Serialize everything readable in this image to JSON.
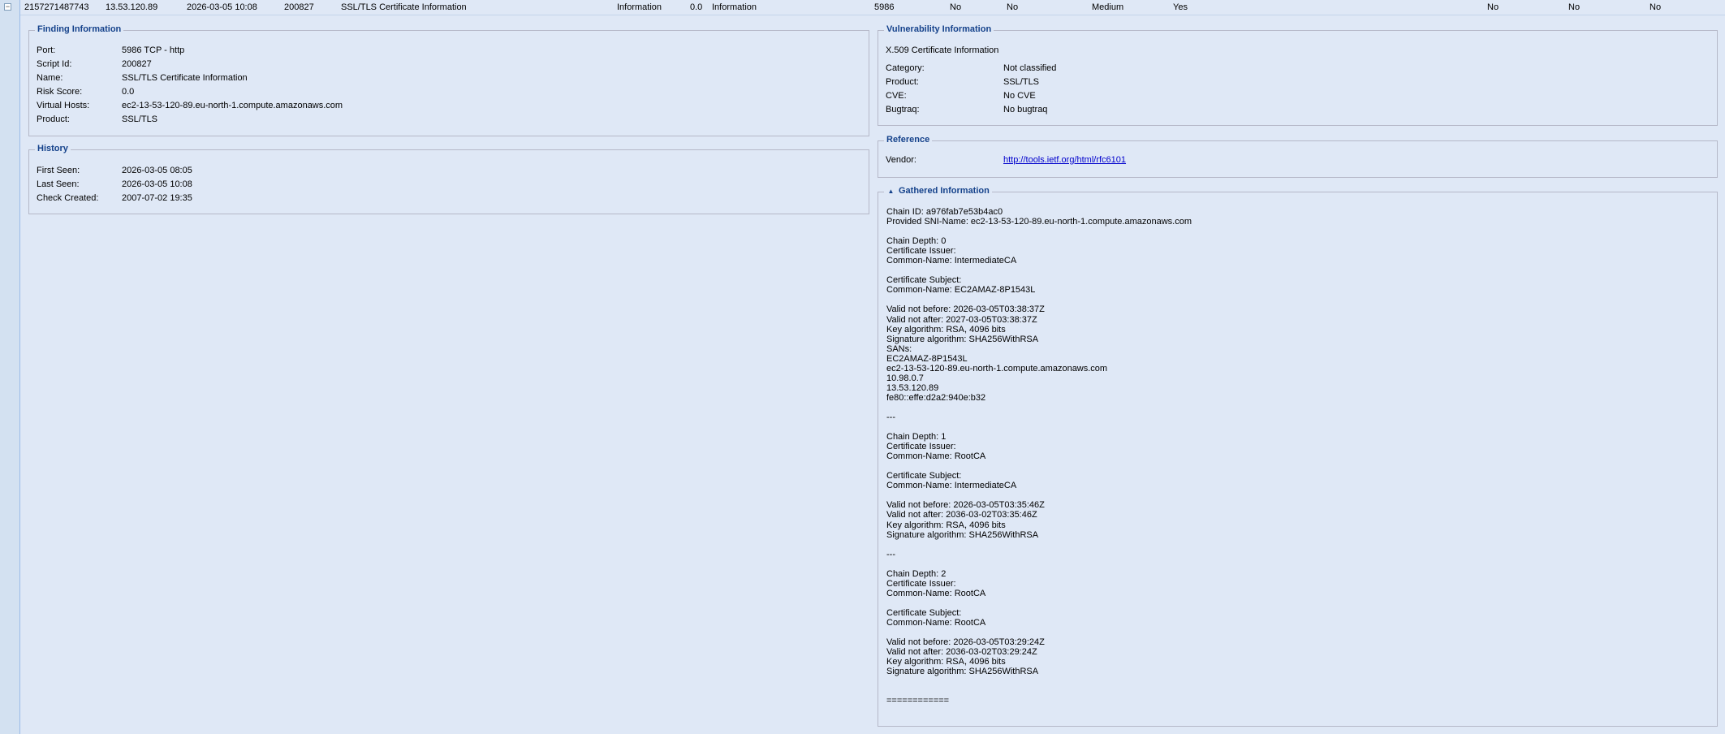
{
  "row": {
    "cells": [
      "2157271487743",
      "13.53.120.89",
      "2026-03-05 10:08",
      "200827",
      "SSL/TLS Certificate Information",
      "Information",
      "0.0",
      "Information",
      "5986",
      "No",
      "No",
      "Medium",
      "Yes",
      "No",
      "No",
      "No"
    ]
  },
  "finding": {
    "title": "Finding Information",
    "fields": [
      {
        "label": "Port:",
        "value": "5986 TCP - http"
      },
      {
        "label": "Script Id:",
        "value": "200827"
      },
      {
        "label": "Name:",
        "value": "SSL/TLS Certificate Information"
      },
      {
        "label": "Risk Score:",
        "value": "0.0"
      },
      {
        "label": "Virtual Hosts:",
        "value": "ec2-13-53-120-89.eu-north-1.compute.amazonaws.com"
      },
      {
        "label": "Product:",
        "value": "SSL/TLS"
      }
    ]
  },
  "history": {
    "title": "History",
    "fields": [
      {
        "label": "First Seen:",
        "value": "2026-03-05 08:05"
      },
      {
        "label": "Last Seen:",
        "value": "2026-03-05 10:08"
      },
      {
        "label": "Check Created:",
        "value": "2007-07-02 19:35"
      }
    ]
  },
  "vulnerability": {
    "title": "Vulnerability Information",
    "heading": "X.509 Certificate Information",
    "fields": [
      {
        "label": "Category:",
        "value": "Not classified"
      },
      {
        "label": "Product:",
        "value": "SSL/TLS"
      },
      {
        "label": "CVE:",
        "value": "No CVE"
      },
      {
        "label": "Bugtraq:",
        "value": "No bugtraq"
      }
    ]
  },
  "reference": {
    "title": "Reference",
    "vendor_label": "Vendor:",
    "vendor_link": "http://tools.ietf.org/html/rfc6101"
  },
  "gathered": {
    "title": "Gathered Information",
    "text": "Chain ID: a976fab7e53b4ac0\nProvided SNI-Name: ec2-13-53-120-89.eu-north-1.compute.amazonaws.com\n\nChain Depth: 0\nCertificate Issuer:\nCommon-Name: IntermediateCA\n\nCertificate Subject:\nCommon-Name: EC2AMAZ-8P1543L\n\nValid not before: 2026-03-05T03:38:37Z\nValid not after: 2027-03-05T03:38:37Z\nKey algorithm: RSA, 4096 bits\nSignature algorithm: SHA256WithRSA\nSANs:\nEC2AMAZ-8P1543L\nec2-13-53-120-89.eu-north-1.compute.amazonaws.com\n10.98.0.7\n13.53.120.89\nfe80::effe:d2a2:940e:b32\n\n---\n\nChain Depth: 1\nCertificate Issuer:\nCommon-Name: RootCA\n\nCertificate Subject:\nCommon-Name: IntermediateCA\n\nValid not before: 2026-03-05T03:35:46Z\nValid not after: 2036-03-02T03:35:46Z\nKey algorithm: RSA, 4096 bits\nSignature algorithm: SHA256WithRSA\n\n---\n\nChain Depth: 2\nCertificate Issuer:\nCommon-Name: RootCA\n\nCertificate Subject:\nCommon-Name: RootCA\n\nValid not before: 2026-03-05T03:29:24Z\nValid not after: 2036-03-02T03:29:24Z\nKey algorithm: RSA, 4096 bits\nSignature algorithm: SHA256WithRSA\n\n\n============"
  }
}
